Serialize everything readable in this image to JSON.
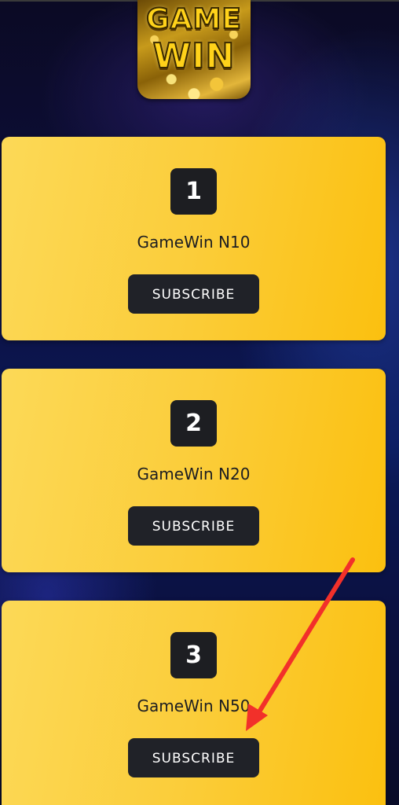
{
  "logo": {
    "line1": "GAME",
    "line2": "WIN"
  },
  "plans": [
    {
      "number": "1",
      "name": "GameWin N10",
      "button_label": "SUBSCRIBE"
    },
    {
      "number": "2",
      "name": "GameWin N20",
      "button_label": "SUBSCRIBE"
    },
    {
      "number": "3",
      "name": "GameWin N50",
      "button_label": "SUBSCRIBE"
    }
  ],
  "colors": {
    "card_yellow": "#fbcd3a",
    "dark": "#1d1e22",
    "arrow_red": "#f2302a"
  }
}
